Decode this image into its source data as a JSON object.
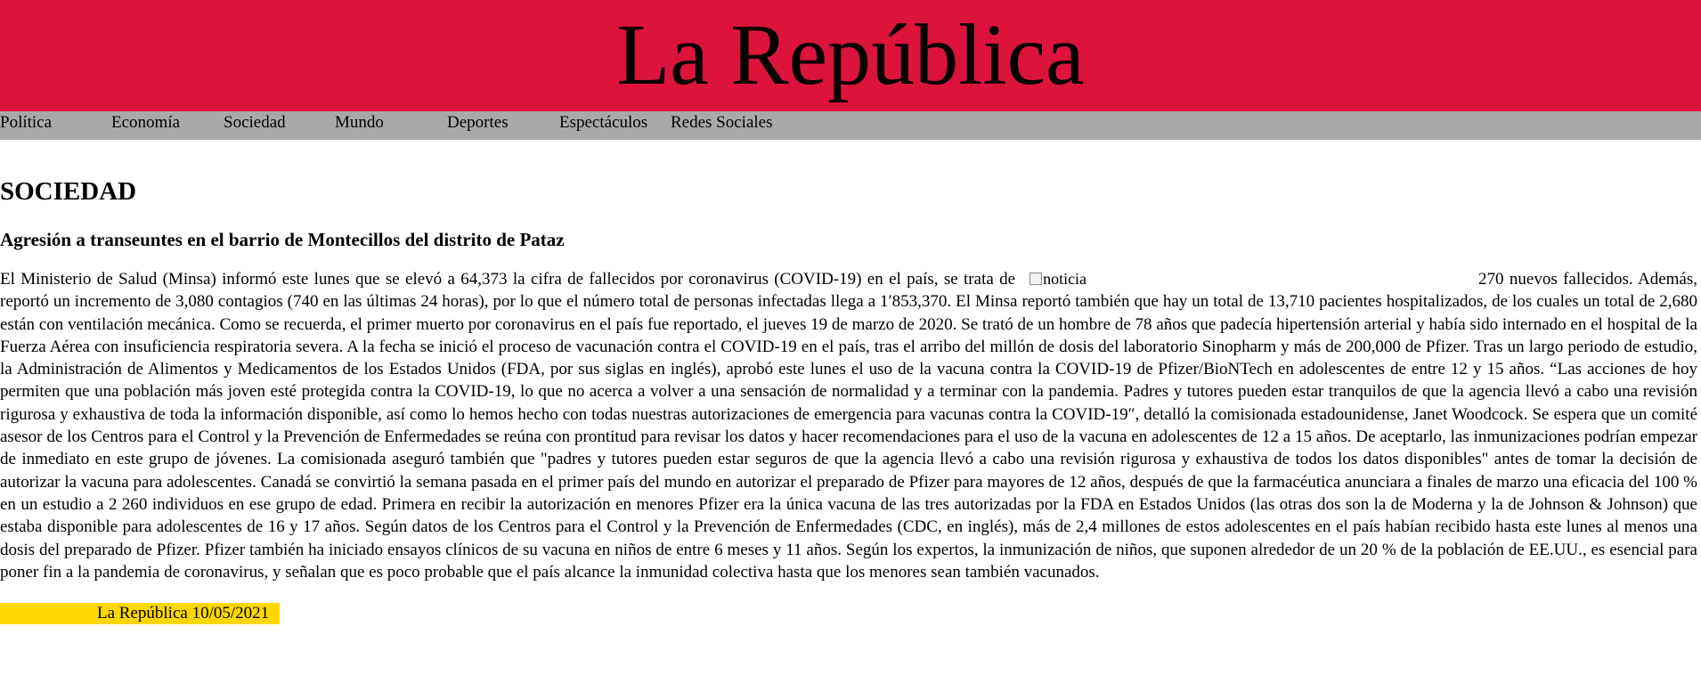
{
  "header": {
    "title": "La República"
  },
  "nav": {
    "items": [
      {
        "label": "Política"
      },
      {
        "label": "Economía"
      },
      {
        "label": "Sociedad"
      },
      {
        "label": "Mundo"
      },
      {
        "label": "Deportes"
      },
      {
        "label": "Espectáculos"
      },
      {
        "label": "Redes Sociales"
      }
    ]
  },
  "colors": {
    "masthead": "#dc143c",
    "navbar": "#a9a9a9",
    "footer_highlight": "#ffd700"
  },
  "main": {
    "section": "SOCIEDAD",
    "headline": "Agresión a transeuntes en el barrio de Montecillos del distrito de Pataz",
    "body_intro": "El Ministerio de Salud (Minsa) informó este lunes que se elevó a 64,373 la cifra de fallecidos por coronavirus (COVID-19) en el país, se trata de",
    "image_alt": "noticia",
    "body_rest": "270 nuevos fallecidos. Además, reportó un incremento de 3,080 contagios (740 en las últimas 24 horas), por lo que el número total de personas infectadas llega a 1′853,370. El Minsa reportó también que hay un total de 13,710 pacientes hospitalizados, de los cuales un total de 2,680 están con ventilación mecánica. Como se recuerda, el primer muerto por coronavirus en el país fue reportado, el jueves 19 de marzo de 2020. Se trató de un hombre de 78 años que padecía hipertensión arterial y había sido internado en el hospital de la Fuerza Aérea con insuficiencia respiratoria severa. A la fecha se inició el proceso de vacunación contra el COVID-19 en el país, tras el arribo del millón de dosis del laboratorio Sinopharm y más de 200,000 de Pfizer. Tras un largo periodo de estudio, la Administración de Alimentos y Medicamentos de los Estados Unidos (FDA, por sus siglas en inglés), aprobó este lunes el uso de la vacuna contra la COVID-19 de Pfizer/BioNTech en adolescentes de entre 12 y 15 años. “Las acciones de hoy permiten que una población más joven esté protegida contra la COVID-19, lo que no acerca a volver a una sensación de normalidad y a terminar con la pandemia. Padres y tutores pueden estar tranquilos de que la agencia llevó a cabo una revisión rigurosa y exhaustiva de toda la información disponible, así como lo hemos hecho con todas nuestras autorizaciones de emergencia para vacunas contra la COVID-19″, detalló la comisionada estadounidense, Janet Woodcock. Se espera que un comité asesor de los Centros para el Control y la Prevención de Enfermedades se reúna con prontitud para revisar los datos y hacer recomendaciones para el uso de la vacuna en adolescentes de 12 a 15 años. De aceptarlo, las inmunizaciones podrían empezar de inmediato en este grupo de jóvenes. La comisionada aseguró también que \"padres y tutores pueden estar seguros de que la agencia llevó a cabo una revisión rigurosa y exhaustiva de todos los datos disponibles\" antes de tomar la decisión de autorizar la vacuna para adolescentes. Canadá se convirtió la semana pasada en el primer país del mundo en autorizar el preparado de Pfizer para mayores de 12 años, después de que la farmacéutica anunciara a finales de marzo una eficacia del 100 % en un estudio a 2 260 individuos en ese grupo de edad. Primera en recibir la autorización en menores Pfizer era la única vacuna de las tres autorizadas por la FDA en Estados Unidos (las otras dos son la de Moderna y la de Johnson & Johnson) que estaba disponible para adolescentes de 16 y 17 años. Según datos de los Centros para el Control y la Prevención de Enfermedades (CDC, en inglés), más de 2,4 millones de estos adolescentes en el país habían recibido hasta este lunes al menos una dosis del preparado de Pfizer. Pfizer también ha iniciado ensayos clínicos de su vacuna en niños de entre 6 meses y 11 años. Según los expertos, la inmunización de niños, que suponen alrededor de un 20 % de la población de EE.UU., es esencial para poner fin a la pandemia de coronavirus, y señalan que es poco probable que el país alcance la inmunidad colectiva hasta que los menores sean también vacunados.",
    "footer": "La República 10/05/2021"
  }
}
